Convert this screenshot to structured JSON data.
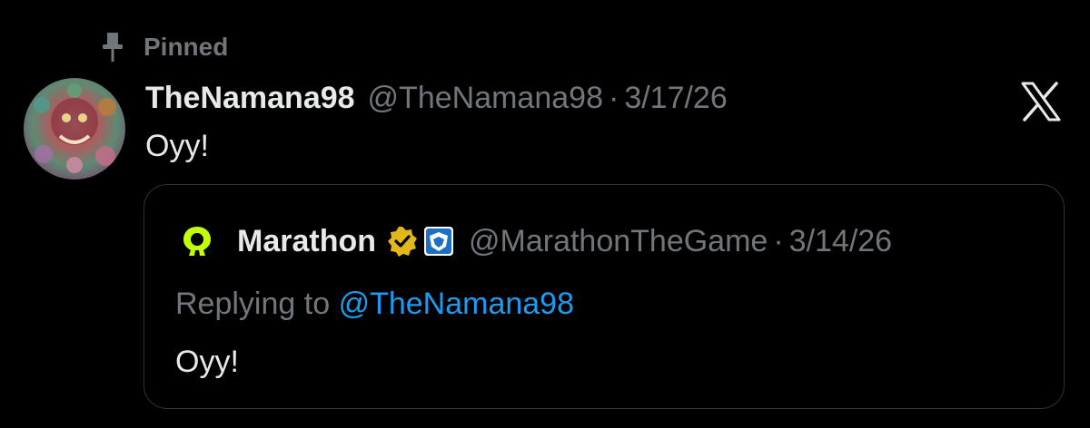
{
  "pinned": {
    "label": "Pinned",
    "icon": "pin-icon"
  },
  "tweet": {
    "author_name": "TheNamana98",
    "author_handle": "@TheNamana98",
    "separator": "·",
    "date": "3/17/26",
    "text": "Oyy!",
    "avatar_icon": "avatar-image"
  },
  "brand": {
    "icon": "x-logo-icon"
  },
  "quote": {
    "author_name": "Marathon",
    "author_handle": "@MarathonTheGame",
    "separator": "·",
    "date": "3/14/26",
    "replying_label": "Replying to",
    "reply_mention": "@TheNamana98",
    "text": "Oyy!",
    "avatar_icon": "marathon-logo-icon",
    "verified_icon": "verified-gold-badge-icon",
    "affiliate_icon": "affiliate-badge-icon"
  },
  "colors": {
    "background": "#000000",
    "primary_text": "#e7e9ea",
    "secondary_text": "#71767b",
    "link": "#1d9bf0",
    "border": "#2f3336",
    "verified_gold": "#e2b719",
    "marathon_green": "#c2fe0b"
  }
}
